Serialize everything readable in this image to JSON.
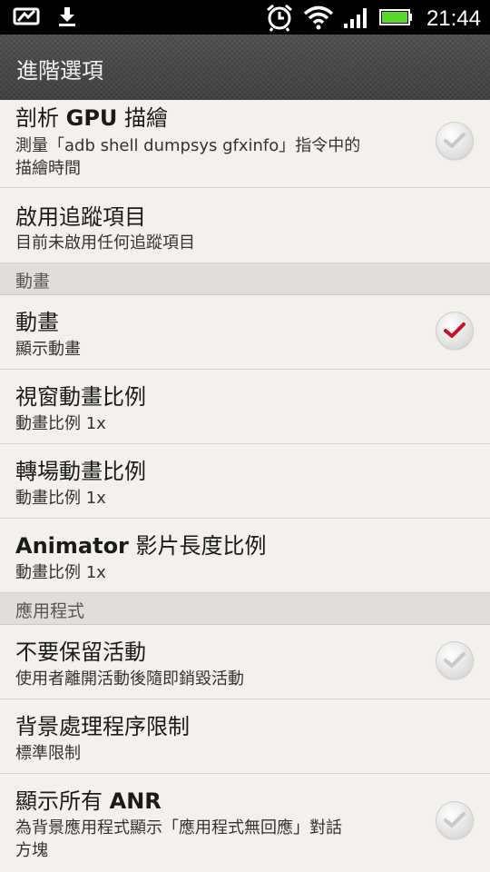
{
  "status_bar": {
    "time": "21:44",
    "left_icons": [
      "screenshot-icon",
      "download-icon"
    ],
    "right_icons": [
      "alarm-icon",
      "wifi-icon",
      "signal-icon",
      "battery-icon"
    ]
  },
  "header": {
    "title": "進階選項"
  },
  "items": {
    "gpu": {
      "title_prefix": "剖析 ",
      "title_bold": "GPU",
      "title_suffix": " 描繪",
      "subtitle_line1": "測量「adb shell dumpsys gfxinfo」指令中的",
      "subtitle_line2": "描繪時間",
      "checked": false
    },
    "trace": {
      "title": "啟用追蹤項目",
      "subtitle": "目前未啟用任何追蹤項目"
    },
    "animation": {
      "title": "動畫",
      "subtitle": "顯示動畫",
      "checked": true
    },
    "window_scale": {
      "title": "視窗動畫比例",
      "subtitle": "動畫比例 1x"
    },
    "transition_scale": {
      "title": "轉場動畫比例",
      "subtitle": "動畫比例 1x"
    },
    "animator_scale": {
      "title_bold": "Animator",
      "title_suffix": " 影片長度比例",
      "subtitle": "動畫比例 1x"
    },
    "dont_keep": {
      "title": "不要保留活動",
      "subtitle": "使用者離開活動後隨即銷毀活動",
      "checked": false
    },
    "bg_limit": {
      "title": "背景處理程序限制",
      "subtitle": "標準限制"
    },
    "anr": {
      "title_prefix": "顯示所有 ",
      "title_bold": "ANR",
      "subtitle_line1": "為背景應用程式顯示「應用程式無回應」對話",
      "subtitle_line2": "方塊",
      "checked": false
    }
  },
  "sections": {
    "animation": "動畫",
    "apps": "應用程式"
  },
  "colors": {
    "check_red": "#c8102e",
    "check_gray": "#c8c8c8",
    "list_bg": "#f4f1ed",
    "section_bg": "#e2ddd8"
  }
}
